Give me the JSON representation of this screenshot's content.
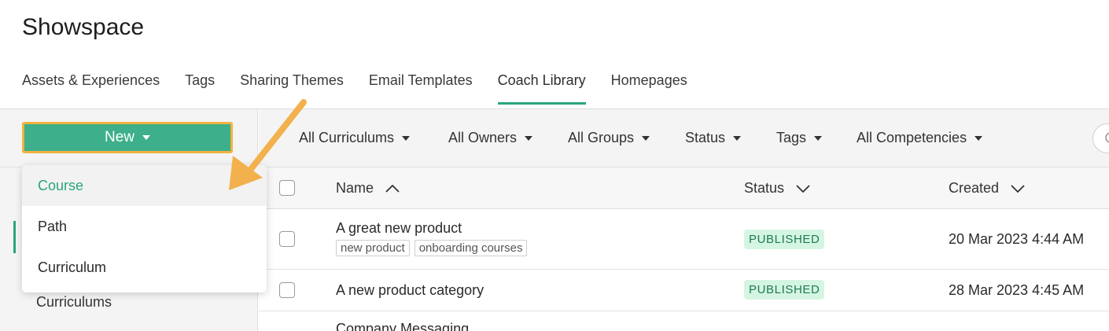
{
  "app": {
    "title": "Showspace"
  },
  "tabs": [
    {
      "label": "Assets & Experiences",
      "active": false
    },
    {
      "label": "Tags",
      "active": false
    },
    {
      "label": "Sharing Themes",
      "active": false
    },
    {
      "label": "Email Templates",
      "active": false
    },
    {
      "label": "Coach Library",
      "active": true
    },
    {
      "label": "Homepages",
      "active": false
    }
  ],
  "toolbar": {
    "new_label": "New"
  },
  "new_menu": {
    "items": [
      "Course",
      "Path",
      "Curriculum"
    ],
    "highlighted": "Course"
  },
  "filters": [
    "All Curriculums",
    "All Owners",
    "All Groups",
    "Status",
    "Tags",
    "All Competencies"
  ],
  "sidebar": {
    "items": [
      "Curriculums"
    ]
  },
  "table": {
    "columns": {
      "name": "Name",
      "status": "Status",
      "created": "Created"
    },
    "rows": [
      {
        "name": "A great new product",
        "tags": [
          "new product",
          "onboarding courses"
        ],
        "status": "PUBLISHED",
        "created": "20 Mar 2023 4:44 AM"
      },
      {
        "name": "A new product category",
        "tags": [],
        "status": "PUBLISHED",
        "created": "28 Mar 2023 4:45 AM"
      },
      {
        "name": "Company Messaging",
        "tags": [],
        "status": "",
        "created": ""
      }
    ]
  },
  "colors": {
    "accent": "#2aa57e",
    "button": "#3daf8a",
    "highlight_border": "#f0b341",
    "annotation_arrow": "#f2b14d",
    "badge_bg": "#d5f5e3",
    "badge_text": "#1f7a52"
  },
  "icons": [
    "caret-down-icon",
    "sort-ascending-icon",
    "chevron-down-icon",
    "search-icon"
  ]
}
